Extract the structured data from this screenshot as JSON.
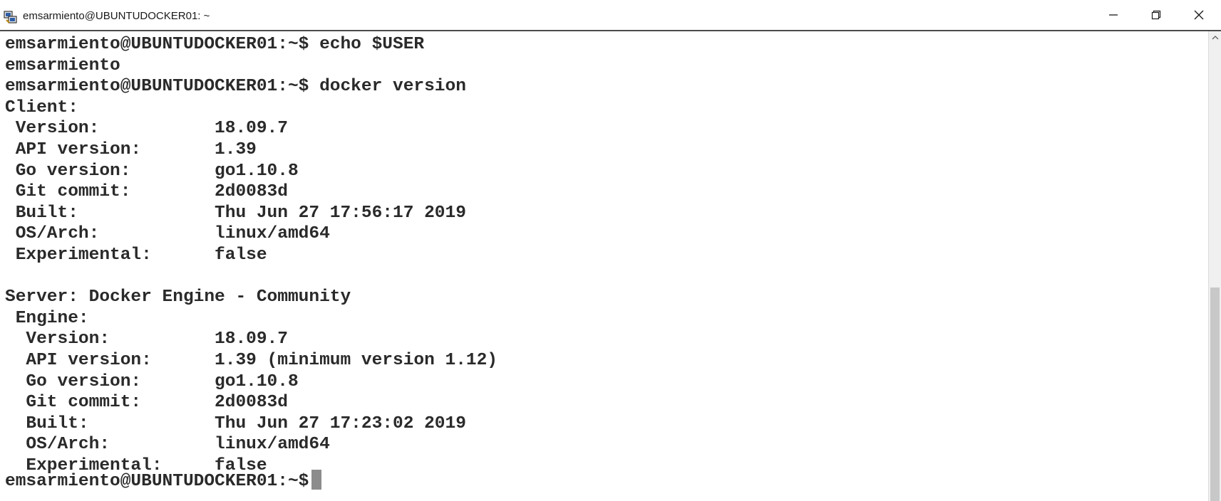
{
  "window": {
    "title": "emsarmiento@UBUNTUDOCKER01: ~",
    "app_icon": "putty-icon",
    "controls": {
      "minimize_icon": "minimize-icon",
      "maximize_icon": "restore-icon",
      "close_icon": "close-icon"
    }
  },
  "terminal": {
    "lines": [
      "emsarmiento@UBUNTUDOCKER01:~$ echo $USER",
      "emsarmiento",
      "emsarmiento@UBUNTUDOCKER01:~$ docker version",
      "Client:",
      " Version:           18.09.7",
      " API version:       1.39",
      " Go version:        go1.10.8",
      " Git commit:        2d0083d",
      " Built:             Thu Jun 27 17:56:17 2019",
      " OS/Arch:           linux/amd64",
      " Experimental:      false",
      "",
      "Server: Docker Engine - Community",
      " Engine:",
      "  Version:          18.09.7",
      "  API version:      1.39 (minimum version 1.12)",
      "  Go version:       go1.10.8",
      "  Git commit:       2d0083d",
      "  Built:            Thu Jun 27 17:23:02 2019",
      "  OS/Arch:          linux/amd64",
      "  Experimental:     false"
    ],
    "current_prompt": "emsarmiento@UBUNTUDOCKER01:~$"
  },
  "colors": {
    "text": "#2a2a2a",
    "background": "#ffffff",
    "cursor": "#8c8c8c",
    "title_border": "#4a4a4a"
  }
}
